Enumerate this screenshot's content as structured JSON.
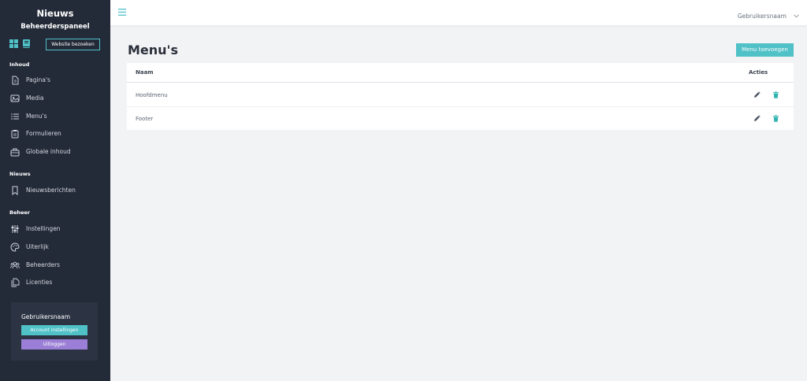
{
  "brand": {
    "title": "Nieuws",
    "subtitle": "Beheerderspaneel"
  },
  "quickbar": {
    "visit_label": "Website bezoeken"
  },
  "sections": {
    "content": "Inhoud",
    "news": "Nieuws",
    "admin": "Beheer"
  },
  "nav": {
    "content": [
      {
        "label": "Pagina's",
        "icon": "page-icon"
      },
      {
        "label": "Media",
        "icon": "image-icon"
      },
      {
        "label": "Menu's",
        "icon": "list-icon"
      },
      {
        "label": "Formulieren",
        "icon": "clipboard-icon"
      },
      {
        "label": "Globale inhoud",
        "icon": "briefcase-icon"
      }
    ],
    "news": [
      {
        "label": "Nieuwsberichten",
        "icon": "bookmark-icon"
      }
    ],
    "admin": [
      {
        "label": "Instellingen",
        "icon": "sliders-icon"
      },
      {
        "label": "Uiterlijk",
        "icon": "palette-icon"
      },
      {
        "label": "Beheerders",
        "icon": "users-icon"
      },
      {
        "label": "Licenties",
        "icon": "documents-icon"
      }
    ]
  },
  "user_card": {
    "username": "Gebruikersnaam",
    "account_label": "Account instellingen",
    "logout_label": "Uitloggen"
  },
  "topbar": {
    "username": "Gebruikersnaam"
  },
  "main": {
    "title": "Menu's",
    "add_label": "Menu toevoegen",
    "columns": {
      "name": "Naam",
      "actions": "Acties"
    },
    "rows": [
      {
        "name": "Hoofdmenu"
      },
      {
        "name": "Footer"
      }
    ]
  },
  "colors": {
    "sidebar": "#232a38",
    "accent": "#4fc1c7",
    "logout": "#9b7fd6",
    "delete": "#2fb3b0"
  }
}
